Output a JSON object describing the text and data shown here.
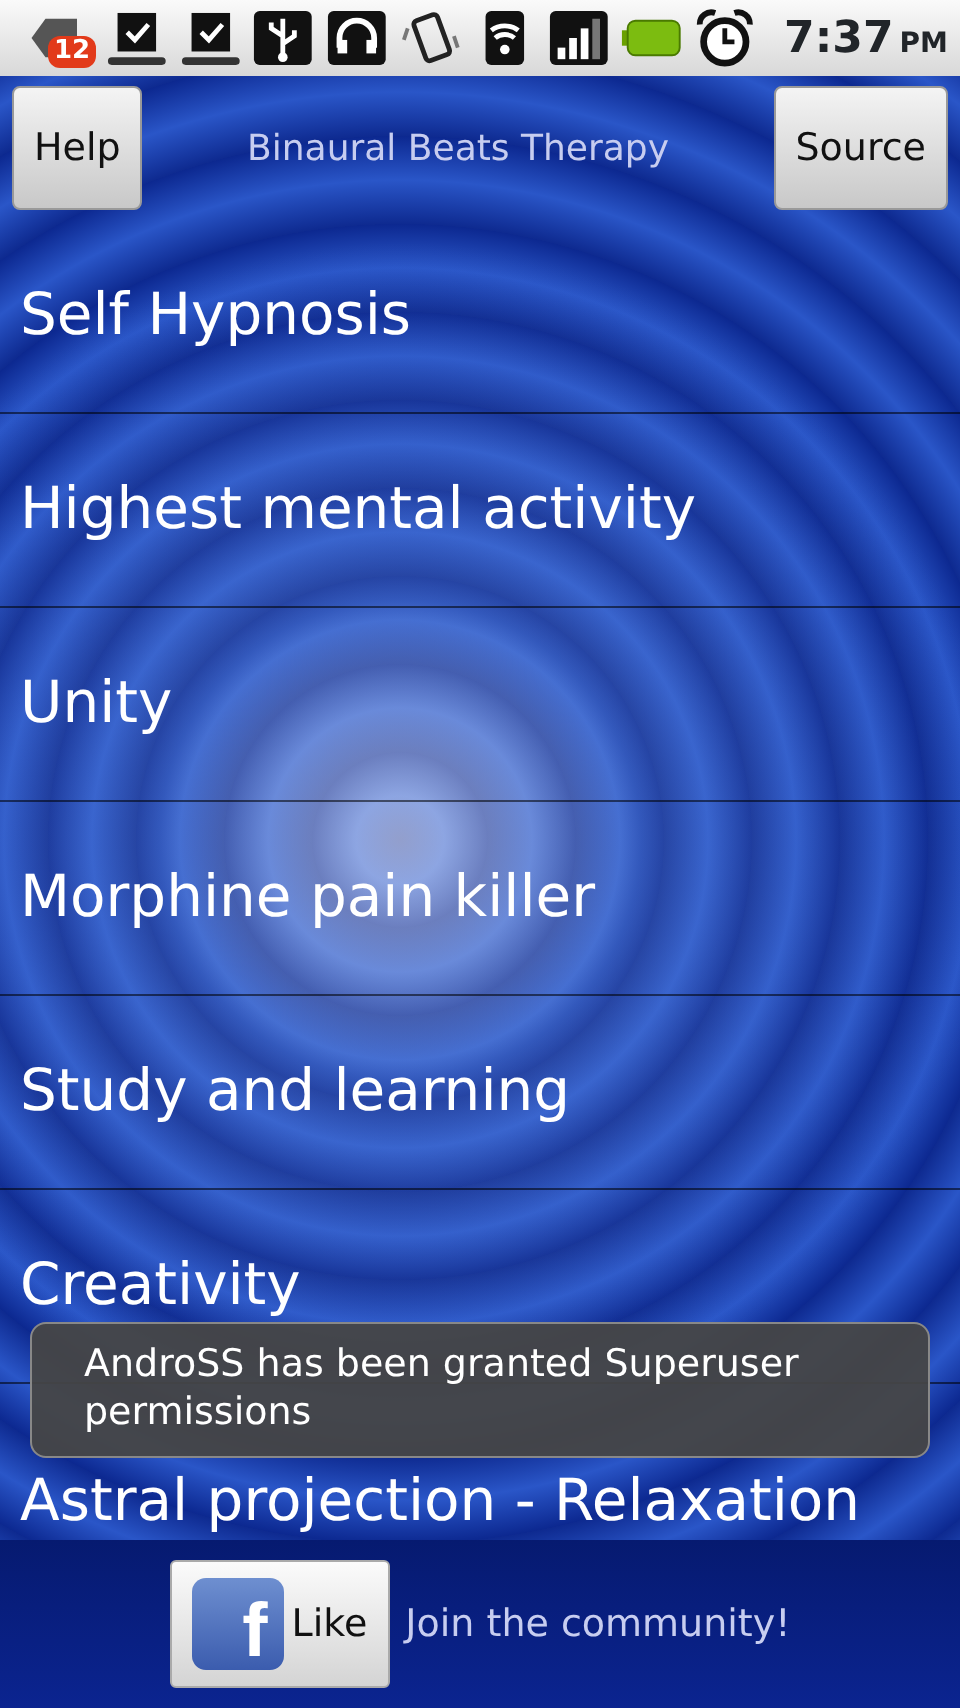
{
  "status_bar": {
    "notification_count": "12",
    "time": "7:37",
    "meridiem": "PM"
  },
  "header": {
    "title": "Binaural Beats Therapy",
    "left_button": "Help",
    "right_button": "Source"
  },
  "therapies": [
    {
      "label": "Self Hypnosis"
    },
    {
      "label": "Highest mental activity"
    },
    {
      "label": "Unity"
    },
    {
      "label": "Morphine pain killer"
    },
    {
      "label": "Study and learning"
    },
    {
      "label": "Creativity"
    },
    {
      "label": "Astral projection - Relaxation"
    }
  ],
  "toast": {
    "message": "AndroSS has been granted Superuser permissions"
  },
  "footer": {
    "like_button": {
      "icon_letter": "f",
      "label": "Like"
    },
    "caption": "Join the community!"
  }
}
